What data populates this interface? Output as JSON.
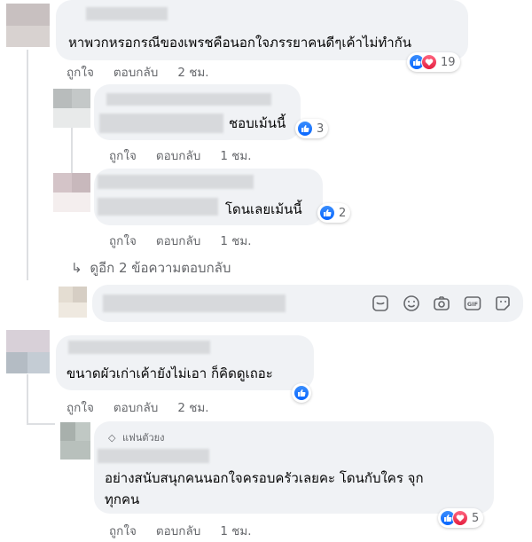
{
  "comments": [
    {
      "text": "หาพวกหรอกรณีของเพรชคือนอกใจภรรยาคนดีๆเค้าไม่ทำกัน",
      "actions": {
        "like": "ถูกใจ",
        "reply": "ตอบกลับ",
        "time": "2 ชม."
      },
      "reaction_count": "19"
    },
    {
      "text": "ชอบเม้นนี้",
      "actions": {
        "like": "ถูกใจ",
        "reply": "ตอบกลับ",
        "time": "1 ชม."
      },
      "reaction_count": "3"
    },
    {
      "text": "โดนเลยเม้นนี้",
      "actions": {
        "like": "ถูกใจ",
        "reply": "ตอบกลับ",
        "time": "1 ชม."
      },
      "reaction_count": "2"
    },
    {
      "text": "ขนาดผัวเก่าเค้ายังไม่เอา ก็คิดดูเถอะ",
      "actions": {
        "like": "ถูกใจ",
        "reply": "ตอบกลับ",
        "time": "2 ชม."
      }
    },
    {
      "badge": "แฟนตัวยง",
      "text_line1": "อย่างสนับสนุกคนนอกใจครอบครัวเลยคะ โดนกับใคร จุก",
      "text_line2": "ทุกคน",
      "actions": {
        "like": "ถูกใจ",
        "reply": "ตอบกลับ",
        "time": "1 ชม."
      },
      "reaction_count": "5"
    }
  ],
  "view_more": "ดูอีก 2 ข้อความตอบกลับ",
  "reply_box": {
    "tools": [
      "sticker-icon",
      "emoji-icon",
      "camera-icon",
      "gif-icon",
      "avatar-sticker-icon"
    ]
  },
  "colors": {
    "bubble": "#f0f2f5",
    "muted_text": "#65676b",
    "like_blue": "#0866ff",
    "love_red": "#e41e3f"
  }
}
